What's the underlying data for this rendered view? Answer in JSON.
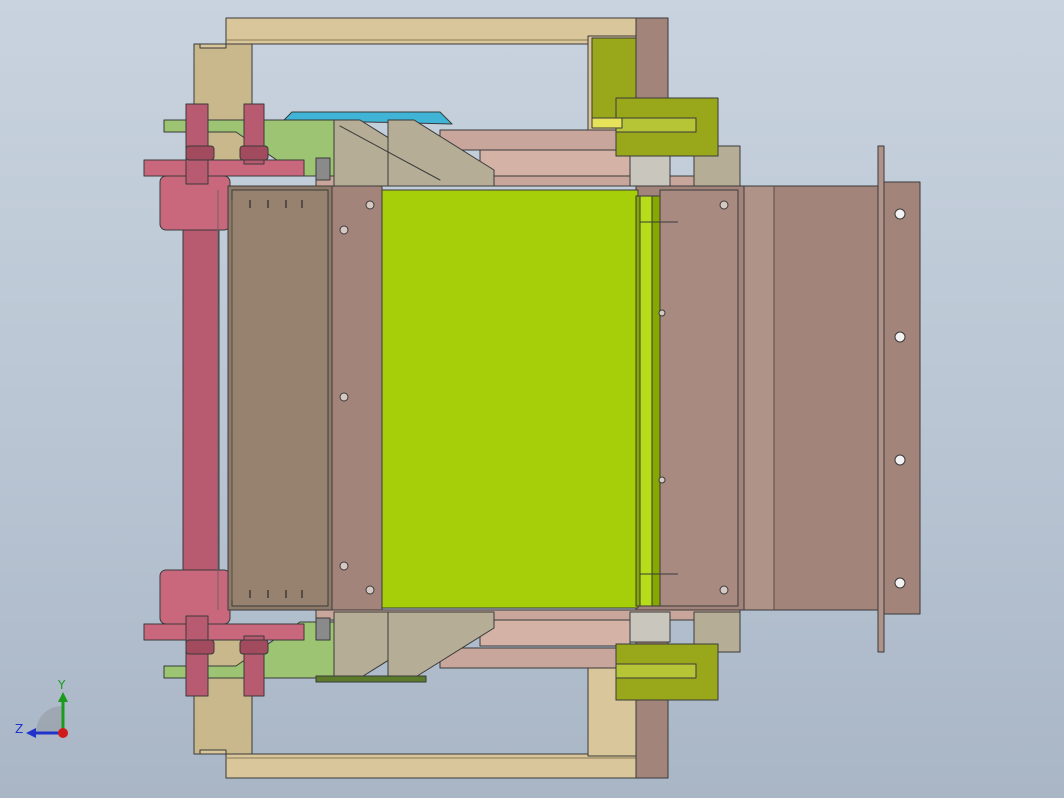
{
  "viewport": {
    "background_top": "#c9d3df",
    "background_bottom": "#a9b6c6"
  },
  "colors": {
    "tan": "#d9c79b",
    "tan_dark": "#b8a57a",
    "mauve": "#a3847a",
    "mauve_light": "#c9a69b",
    "mauve_dark": "#7e6259",
    "pink": "#c9687d",
    "pink_dark": "#a24a5e",
    "lime": "#a7cf09",
    "lime_dark": "#86a800",
    "olive": "#98a81a",
    "green_plate": "#9cc472",
    "gray_beige": "#b5ad95",
    "gray_roller": "#c9c7bd",
    "cyan": "#3fb4d6",
    "outline": "#3a3a3a"
  },
  "triad": {
    "y_label": "Y",
    "z_label": "Z",
    "y_color": "#1c9a1c",
    "z_color": "#2233cc",
    "x_color": "#d11a1a"
  }
}
